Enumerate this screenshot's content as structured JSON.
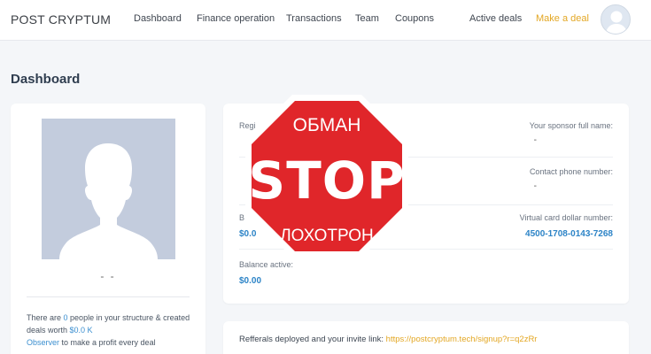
{
  "brand": "POST CRYPTUM",
  "nav": {
    "dashboard": "Dashboard",
    "finance": "Finance operation",
    "transactions": "Transactions",
    "team": "Team",
    "coupons": "Coupons",
    "active_deals": "Active deals",
    "make_deal": "Make a deal"
  },
  "page_title": "Dashboard",
  "profile": {
    "name": "- -",
    "structure_text_1": "There are ",
    "people_count": "0",
    "structure_text_2": " people in your structure & created deals worth ",
    "deals_worth": "$0.0 K",
    "status": "Observer",
    "structure_text_3": " to make a profit every deal"
  },
  "info": {
    "reg_label_partial": "Regi",
    "sponsor_label": "Your sponsor full name:",
    "sponsor_value": "-",
    "phone_label": "Contact phone number:",
    "phone_value": "-",
    "balance1_label_partial": "B",
    "balance1_value_partial": "$0.0",
    "virtual_card_label": "Virtual card dollar number:",
    "virtual_card_value": "4500-1708-0143-7268",
    "balance_active_label": "Balance active:",
    "balance_active_value": "$0.00"
  },
  "referral": {
    "text": "Refferals deployed and your invite link: ",
    "link": "https://postcryptum.tech/signup?r=q2zRr"
  },
  "stop_sign": {
    "top": "ОБМАН",
    "middle": "STOP",
    "bottom": "ЛОХОТРОН",
    "color": "#e0262a"
  },
  "colors": {
    "accent_blue": "#3b8fd0",
    "accent_gold": "#e3a724",
    "background": "#f4f6f9"
  }
}
